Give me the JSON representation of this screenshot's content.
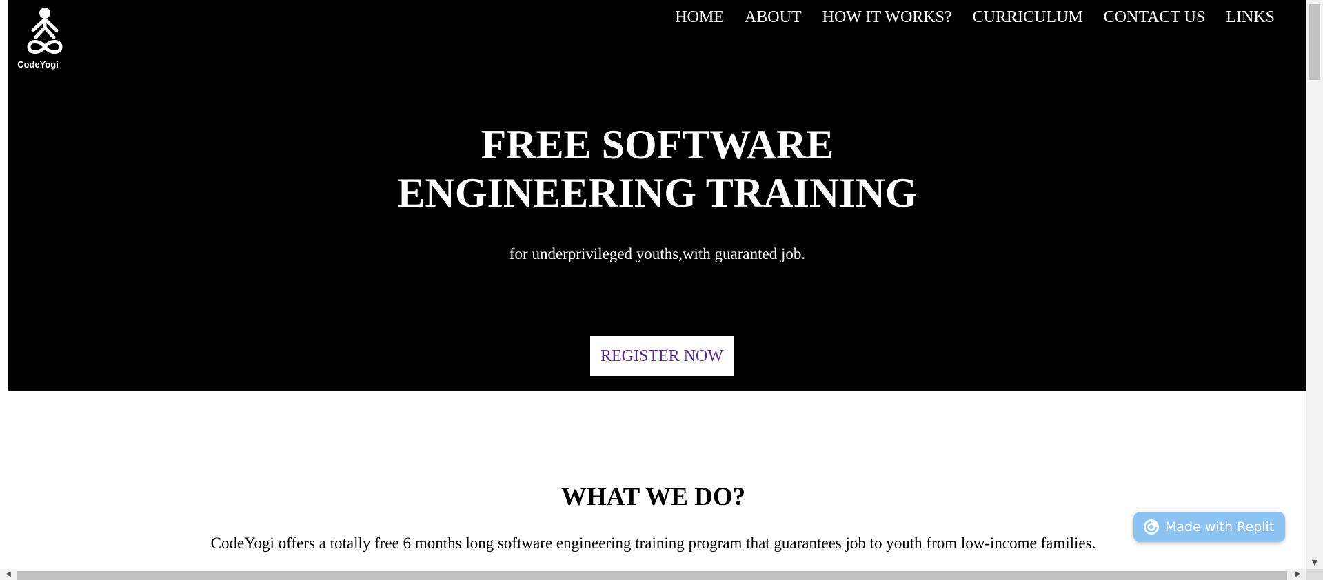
{
  "logo": {
    "text": "CodeYogi"
  },
  "nav": {
    "items": [
      "HOME",
      "ABOUT",
      "HOW IT WORKS?",
      "CURRICULUM",
      "CONTACT US",
      "LINKS"
    ]
  },
  "hero": {
    "title_line1": "FREE SOFTWARE",
    "title_line2": "ENGINEERING TRAINING",
    "subtitle": "for underprivileged youths,with guaranted job.",
    "cta_label": "REGISTER NOW"
  },
  "what_we_do": {
    "title": "WHAT WE DO?",
    "text": "CodeYogi offers a totally free 6 months long software engineering training program that guarantees job to youth from low-income families."
  },
  "replit_badge": {
    "label": "Made with Replit"
  },
  "colors": {
    "hero_bg": "#000000",
    "cta_text": "#5b2a86",
    "badge_bg": "#8bc3f2"
  }
}
